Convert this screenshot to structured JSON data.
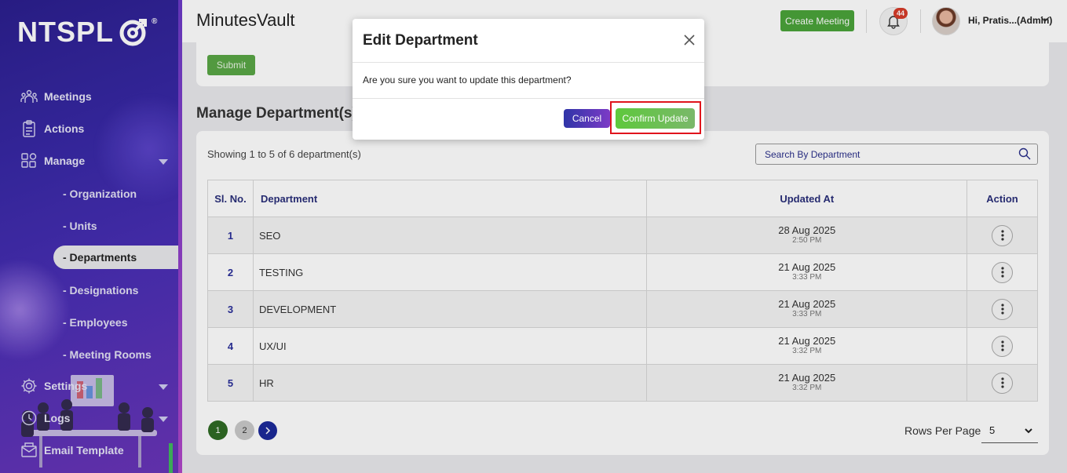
{
  "brand": {
    "logo_text": "NTSPL",
    "reg_mark": "®"
  },
  "sidebar": {
    "items": [
      {
        "label": "Meetings",
        "icon": "meetings-icon"
      },
      {
        "label": "Actions",
        "icon": "clipboard-icon"
      },
      {
        "label": "Manage",
        "icon": "grid-icon",
        "expanded": true
      },
      {
        "label": "Settings",
        "icon": "gear-icon"
      },
      {
        "label": "Logs",
        "icon": "clock-icon"
      },
      {
        "label": "Email Template",
        "icon": "email-icon"
      }
    ],
    "manage_sub": [
      {
        "label": "- Organization"
      },
      {
        "label": "- Units"
      },
      {
        "label": "- Departments",
        "active": true
      },
      {
        "label": "- Designations"
      },
      {
        "label": "- Employees"
      },
      {
        "label": "- Meeting Rooms"
      }
    ]
  },
  "header": {
    "app_title": "MinutesVault",
    "create_meeting": "Create Meeting",
    "notification_count": "44",
    "user_greeting": "Hi, Pratis...(Admin)"
  },
  "form": {
    "submit_label": "Submit"
  },
  "list": {
    "section_title": "Manage Department(s)",
    "showing_text": "Showing 1 to 5 of 6 department(s)",
    "search_placeholder": "Search By Department",
    "columns": [
      "Sl. No.",
      "Department",
      "Updated At",
      "Action"
    ],
    "rows": [
      {
        "sl": "1",
        "department": "SEO",
        "date": "28 Aug 2025",
        "time": "2:50 PM"
      },
      {
        "sl": "2",
        "department": "TESTING",
        "date": "21 Aug 2025",
        "time": "3:33 PM"
      },
      {
        "sl": "3",
        "department": "DEVELOPMENT",
        "date": "21 Aug 2025",
        "time": "3:33 PM"
      },
      {
        "sl": "4",
        "department": "UX/UI",
        "date": "21 Aug 2025",
        "time": "3:32 PM"
      },
      {
        "sl": "5",
        "department": "HR",
        "date": "21 Aug 2025",
        "time": "3:32 PM"
      }
    ],
    "pages": [
      "1",
      "2"
    ],
    "current_page": "1",
    "rows_per_page_label": "Rows Per Page",
    "rows_per_page_value": "5"
  },
  "modal": {
    "title": "Edit Department",
    "message": "Are you sure you want to update this department?",
    "cancel_label": "Cancel",
    "confirm_label": "Confirm Update"
  },
  "colors": {
    "accent_green": "#4aa33a",
    "sidebar_purple": "#3a2aa8",
    "highlight_red": "#e0141c",
    "badge_red": "#d63c2a"
  }
}
